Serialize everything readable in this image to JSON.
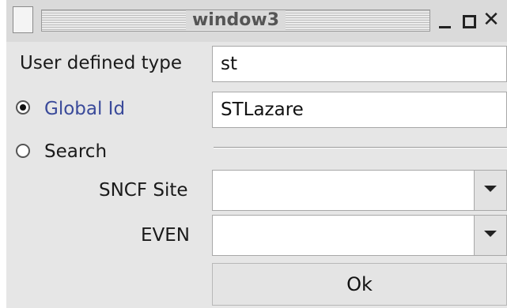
{
  "window": {
    "title": "window3",
    "close_glyph": "✕"
  },
  "form": {
    "user_type_label": "User defined type",
    "user_type_value": "st",
    "global_id_label": "Global Id",
    "global_id_value": "STLazare",
    "search_label": "Search",
    "sncf_site_label": "SNCF Site",
    "even_label": "EVEN",
    "ok_label": "Ok"
  },
  "selection": {
    "radio": "Global Id"
  },
  "colors": {
    "global_id_label": "#3a4a9a"
  }
}
